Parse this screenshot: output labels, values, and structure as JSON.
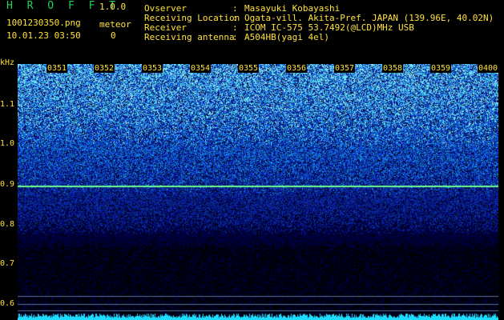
{
  "header": {
    "app_title": "H R O F F T",
    "version": "1.0.0",
    "file_name": "1001230350.png",
    "meteor_label": "meteor",
    "datetime": "10.01.23 03:50",
    "meteor_count": "0"
  },
  "info": [
    {
      "label": "Ovserver",
      "sep": ":",
      "value": "Masayuki Kobayashi"
    },
    {
      "label": "Receiving Location",
      "sep": ":",
      "value": "Ogata-vill. Akita-Pref. JAPAN (139.96E, 40.02N)"
    },
    {
      "label": "Receiver",
      "sep": ":",
      "value": "ICOM IC-575 53.7492(@LCD)MHz USB"
    },
    {
      "label": "Receiving antenna",
      "sep": ":",
      "value": "A504HB(yagi 4el)"
    }
  ],
  "spectrogram": {
    "y_unit": "kHz",
    "y_ticks": [
      "1.1",
      "1.0",
      "0.9",
      "0.8",
      "0.7",
      "0.6"
    ],
    "x_ticks": [
      "0351",
      "0352",
      "0353",
      "0354",
      "0355",
      "0356",
      "0357",
      "0358",
      "0359",
      "0400"
    ],
    "carrier_khz": 0.89,
    "colors": {
      "background": "#000000",
      "label": "#ffe23a",
      "carrier": "#66ff88",
      "baseline": "#22d8ff"
    }
  }
}
